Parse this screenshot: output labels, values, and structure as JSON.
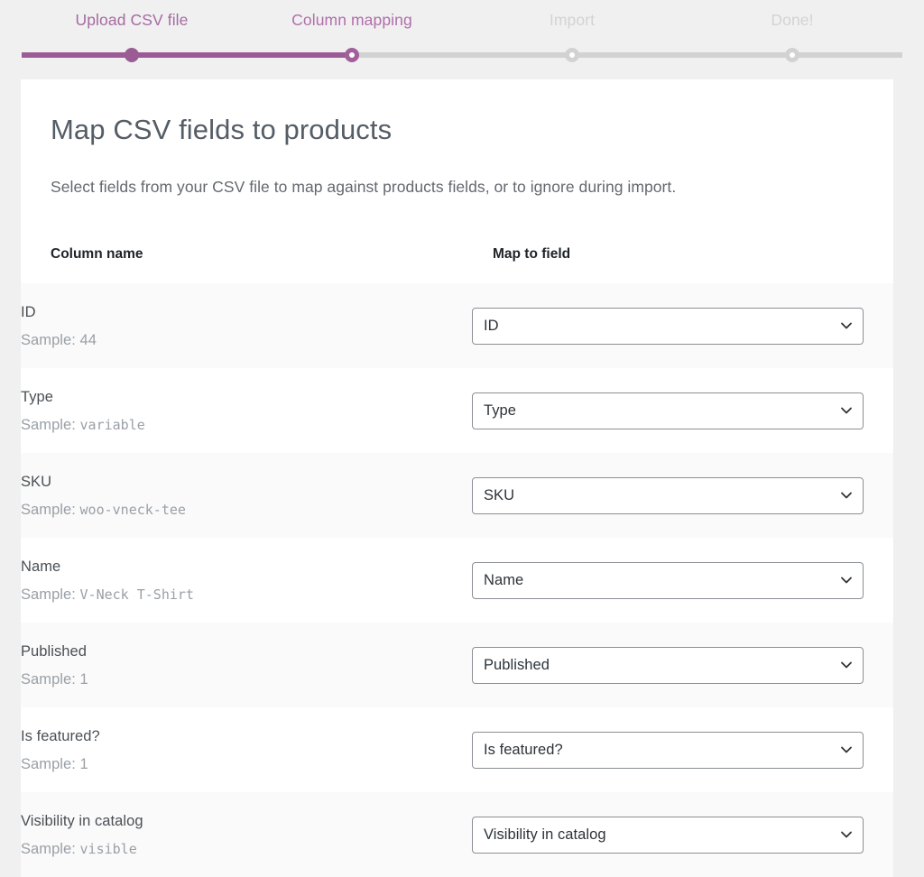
{
  "stepper": {
    "steps": [
      {
        "label": "Upload CSV file",
        "state": "done"
      },
      {
        "label": "Column mapping",
        "state": "current"
      },
      {
        "label": "Import",
        "state": "todo"
      },
      {
        "label": "Done!",
        "state": "todo"
      }
    ],
    "progress_percent": 37,
    "colors": {
      "accent": "#9b5c95",
      "done_label": "#a56ba2",
      "active_label": "#b06fac",
      "todo": "#d3d3d3"
    }
  },
  "card": {
    "title": "Map CSV fields to products",
    "description": "Select fields from your CSV file to map against products fields, or to ignore during import."
  },
  "table": {
    "headers": {
      "column_name": "Column name",
      "map_to_field": "Map to field"
    },
    "sample_prefix": "Sample:",
    "rows": [
      {
        "column": "ID",
        "sample": "44",
        "sample_mono": false,
        "mapped": "ID"
      },
      {
        "column": "Type",
        "sample": "variable",
        "sample_mono": true,
        "mapped": "Type"
      },
      {
        "column": "SKU",
        "sample": "woo-vneck-tee",
        "sample_mono": true,
        "mapped": "SKU"
      },
      {
        "column": "Name",
        "sample": "V-Neck T-Shirt",
        "sample_mono": true,
        "mapped": "Name"
      },
      {
        "column": "Published",
        "sample": "1",
        "sample_mono": false,
        "mapped": "Published"
      },
      {
        "column": "Is featured?",
        "sample": "1",
        "sample_mono": false,
        "mapped": "Is featured?"
      },
      {
        "column": "Visibility in catalog",
        "sample": "visible",
        "sample_mono": true,
        "mapped": "Visibility in catalog"
      }
    ],
    "select_icon": "chevron-down-icon"
  }
}
